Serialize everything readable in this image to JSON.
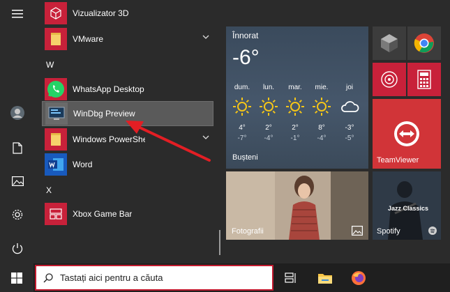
{
  "apps": {
    "vizualizator": "Vizualizator 3D",
    "vmware": "VMware",
    "letter_w": "W",
    "whatsapp": "WhatsApp Desktop",
    "windbg": "WinDbg Preview",
    "powershell": "Windows PowerShell",
    "word": "Word",
    "letter_x": "X",
    "xbox": "Xbox Game Bar"
  },
  "weather": {
    "condition": "Înnorat",
    "temp": "-6°",
    "city": "Bușteni",
    "days": [
      {
        "day": "dum.",
        "hi": "4°",
        "lo": "-7°",
        "icon": "sun-icon"
      },
      {
        "day": "lun.",
        "hi": "2°",
        "lo": "-4°",
        "icon": "sun-icon"
      },
      {
        "day": "mar.",
        "hi": "2°",
        "lo": "-1°",
        "icon": "sun-icon"
      },
      {
        "day": "mie.",
        "hi": "8°",
        "lo": "-4°",
        "icon": "sun-icon"
      },
      {
        "day": "joi",
        "hi": "-3°",
        "lo": "-5°",
        "icon": "cloud-icon"
      }
    ]
  },
  "tiles": {
    "teamviewer": "TeamViewer",
    "photos": "Fotografii",
    "spotify": "Spotify",
    "spotify_art": "Jazz Classics"
  },
  "taskbar": {
    "search_placeholder": "Tastați aici pentru a căuta"
  },
  "colors": {
    "accent_red": "#c21a2f",
    "tile_red": "#d13438",
    "selection": "#5a5a5a"
  }
}
